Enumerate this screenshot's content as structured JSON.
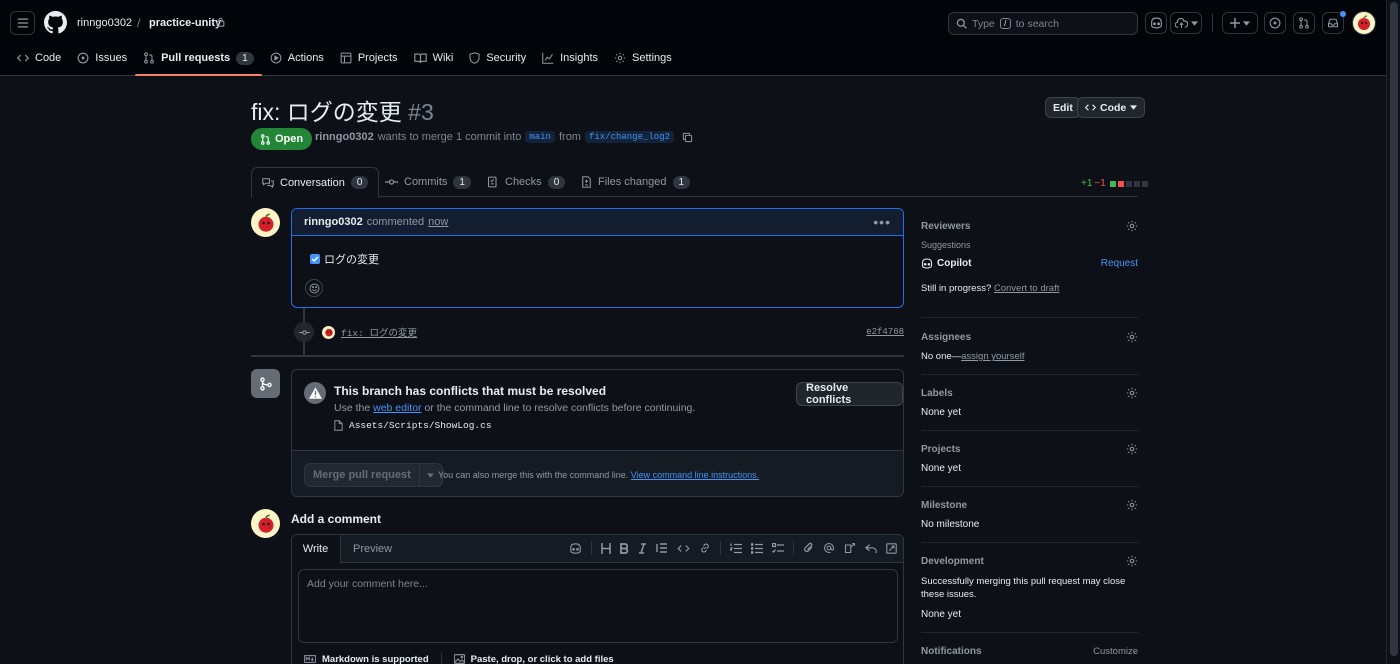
{
  "header": {
    "owner": "rinngo0302",
    "sep": "/",
    "repo": "practice-unity",
    "search_type": "Type",
    "search_key": "/",
    "search_rest": "to search"
  },
  "repo_tabs": [
    {
      "label": "Code"
    },
    {
      "label": "Issues"
    },
    {
      "label": "Pull requests",
      "count": "1"
    },
    {
      "label": "Actions"
    },
    {
      "label": "Projects"
    },
    {
      "label": "Wiki"
    },
    {
      "label": "Security"
    },
    {
      "label": "Insights"
    },
    {
      "label": "Settings"
    }
  ],
  "pr": {
    "title": "fix: ログの変更",
    "number": "#3",
    "edit_label": "Edit",
    "code_label": "Code",
    "state": "Open",
    "author": "rinngo0302",
    "merge_text": "wants to merge 1 commit into",
    "base": "main",
    "from_text": "from",
    "head": "fix/change_log2"
  },
  "pr_tabs": {
    "conversation": {
      "label": "Conversation",
      "count": "0"
    },
    "commits": {
      "label": "Commits",
      "count": "1"
    },
    "checks": {
      "label": "Checks",
      "count": "0"
    },
    "files": {
      "label": "Files changed",
      "count": "1"
    }
  },
  "diffstat": {
    "plus": "+1",
    "minus": "−1"
  },
  "comment": {
    "author": "rinngo0302",
    "action": "commented",
    "time": "now",
    "task": "ログの変更"
  },
  "commit": {
    "message": "fix: ログの変更",
    "sha": "e2f4768"
  },
  "conflict": {
    "title": "This branch has conflicts that must be resolved",
    "use_the": "Use the",
    "web_editor": "web editor",
    "rest": "or the command line to resolve conflicts before continuing.",
    "file": "Assets/Scripts/ShowLog.cs",
    "resolve_label": "Resolve conflicts",
    "merge_label": "Merge pull request",
    "hint": "You can also merge this with the command line.",
    "hint_link": "View command line instructions."
  },
  "add_comment": {
    "title": "Add a comment",
    "write": "Write",
    "preview": "Preview",
    "placeholder": "Add your comment here...",
    "markdown": "Markdown is supported",
    "paste": "Paste, drop, or click to add files"
  },
  "sidebar": {
    "reviewers": "Reviewers",
    "suggestions": "Suggestions",
    "copilot": "Copilot",
    "request": "Request",
    "still": "Still in progress?",
    "convert": "Convert to draft",
    "assignees": "Assignees",
    "no_one": "No one—",
    "assign_yourself": "assign yourself",
    "labels": "Labels",
    "labels_val": "None yet",
    "projects": "Projects",
    "projects_val": "None yet",
    "milestone": "Milestone",
    "milestone_val": "No milestone",
    "development": "Development",
    "development_text": "Successfully merging this pull request may close these issues.",
    "development_val": "None yet",
    "notifications": "Notifications",
    "customize": "Customize"
  },
  "colors": {
    "open": "#238636",
    "accent": "#4493f8",
    "tab_underline": "#f78166",
    "plus": "#3fb950",
    "minus": "#f85149"
  }
}
